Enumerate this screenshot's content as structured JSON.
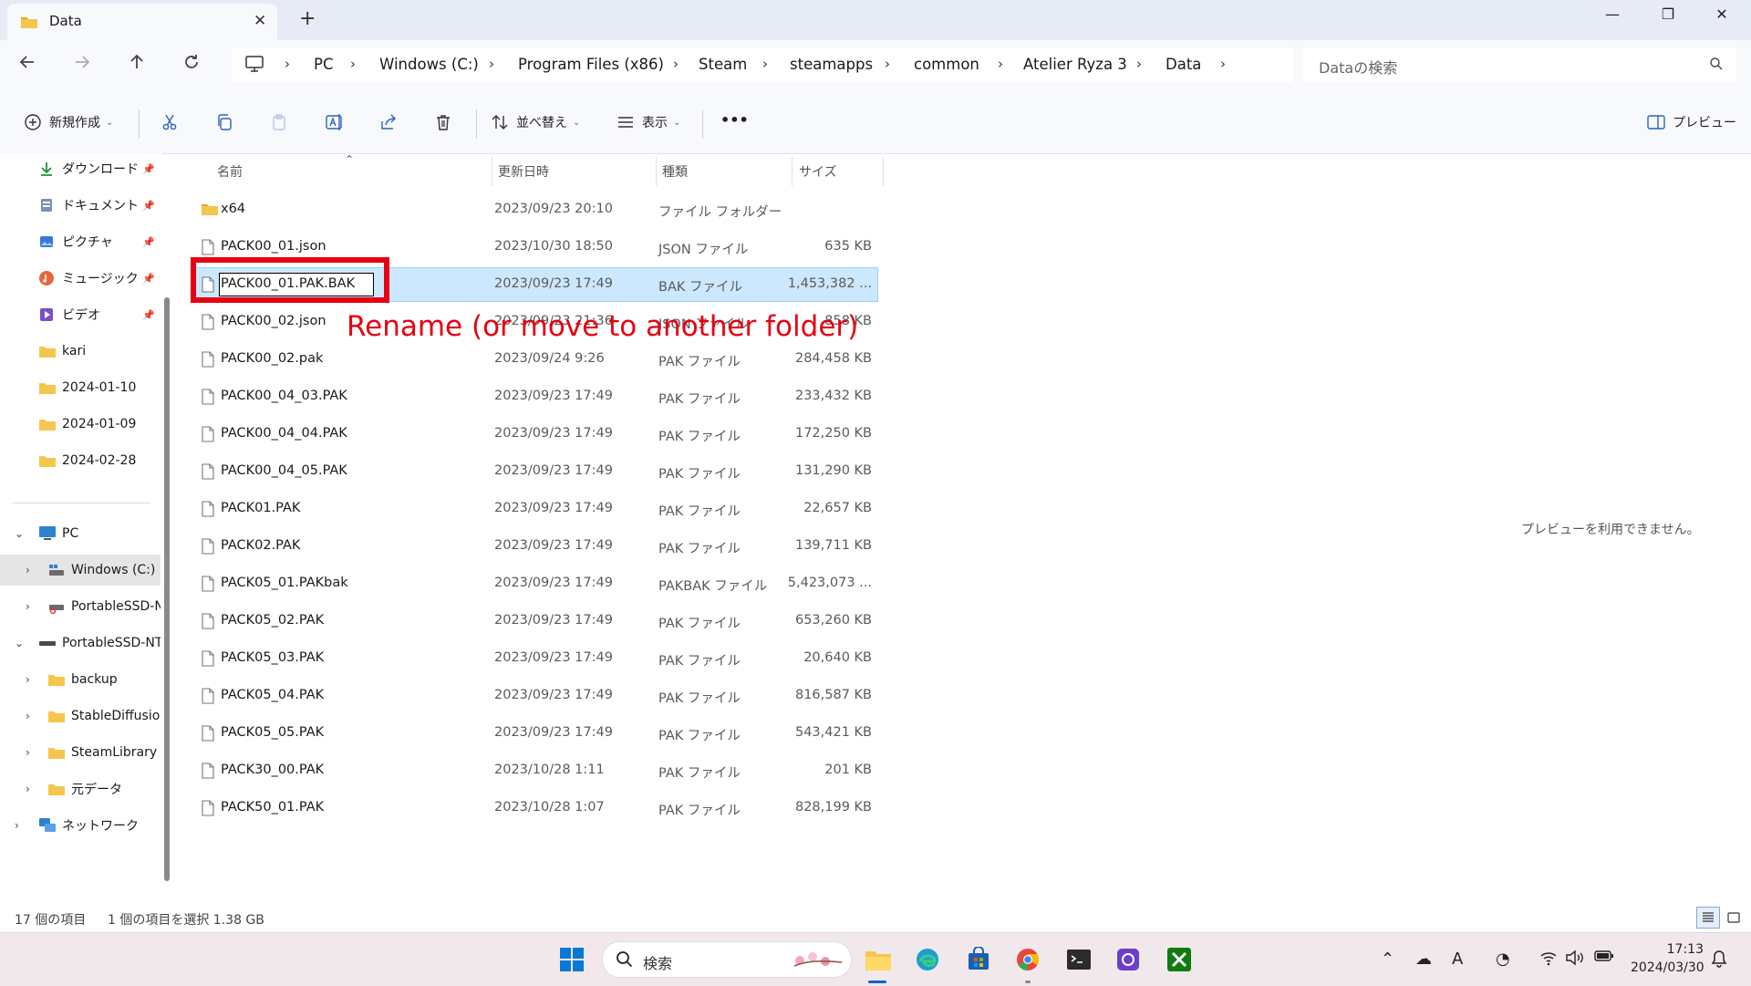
{
  "window": {
    "tab_title": "Data",
    "tab_close": "✕",
    "new_tab": "+",
    "minimize": "—",
    "maximize": "❐",
    "close": "✕"
  },
  "breadcrumb": [
    "PC",
    "Windows (C:)",
    "Program Files (x86)",
    "Steam",
    "steamapps",
    "common",
    "Atelier Ryza 3",
    "Data"
  ],
  "search": {
    "placeholder": "Dataの検索"
  },
  "commandbar": {
    "new_label": "新規作成",
    "sort_label": "並べ替え",
    "view_label": "表示",
    "more_label": "•••",
    "preview_label": "プレビュー"
  },
  "sidebar": {
    "quick_access": [
      {
        "label": "ダウンロード",
        "icon": "download-icon",
        "pinned": true
      },
      {
        "label": "ドキュメント",
        "icon": "documents-icon",
        "pinned": true
      },
      {
        "label": "ピクチャ",
        "icon": "pictures-icon",
        "pinned": true
      },
      {
        "label": "ミュージック",
        "icon": "music-icon",
        "pinned": true
      },
      {
        "label": "ビデオ",
        "icon": "videos-icon",
        "pinned": true
      },
      {
        "label": "kari",
        "icon": "folder-icon",
        "pinned": false
      },
      {
        "label": "2024-01-10",
        "icon": "folder-icon",
        "pinned": false
      },
      {
        "label": "2024-01-09",
        "icon": "folder-icon",
        "pinned": false
      },
      {
        "label": "2024-02-28",
        "icon": "folder-icon",
        "pinned": false
      }
    ],
    "tree": [
      {
        "label": "PC",
        "icon": "pc-icon",
        "expanded": true,
        "level": 0
      },
      {
        "label": "Windows (C:)",
        "icon": "drive-icon",
        "expanded": false,
        "level": 1,
        "selected": true
      },
      {
        "label": "PortableSSD-N",
        "icon": "usb-drive-icon",
        "expanded": false,
        "level": 1
      },
      {
        "label": "PortableSSD-NT",
        "icon": "drive-icon",
        "expanded": true,
        "level": 0
      },
      {
        "label": "backup",
        "icon": "folder-icon",
        "expanded": false,
        "level": 1
      },
      {
        "label": "StableDiffusion",
        "icon": "folder-icon",
        "expanded": false,
        "level": 1
      },
      {
        "label": "SteamLibrary",
        "icon": "folder-icon",
        "expanded": false,
        "level": 1
      },
      {
        "label": "元データ",
        "icon": "folder-icon",
        "expanded": false,
        "level": 1
      },
      {
        "label": "ネットワーク",
        "icon": "network-icon",
        "expanded": false,
        "level": 0
      }
    ]
  },
  "columns": {
    "name": "名前",
    "date": "更新日時",
    "type": "種類",
    "size": "サイズ"
  },
  "files": [
    {
      "name": "x64",
      "date": "2023/09/23 20:10",
      "type": "ファイル フォルダー",
      "size": "",
      "is_folder": true
    },
    {
      "name": "PACK00_01.json",
      "date": "2023/10/30 18:50",
      "type": "JSON ファイル",
      "size": "635 KB"
    },
    {
      "name": "PACK00_01.PAK.BAK",
      "date": "2023/09/23 17:49",
      "type": "BAK ファイル",
      "size": "1,453,382 ...",
      "selected": true,
      "renaming": true
    },
    {
      "name": "PACK00_02.json",
      "date": "2023/09/23 21:36",
      "type": "JSON ファイル",
      "size": "858 KB"
    },
    {
      "name": "PACK00_02.pak",
      "date": "2023/09/24 9:26",
      "type": "PAK ファイル",
      "size": "284,458 KB"
    },
    {
      "name": "PACK00_04_03.PAK",
      "date": "2023/09/23 17:49",
      "type": "PAK ファイル",
      "size": "233,432 KB"
    },
    {
      "name": "PACK00_04_04.PAK",
      "date": "2023/09/23 17:49",
      "type": "PAK ファイル",
      "size": "172,250 KB"
    },
    {
      "name": "PACK00_04_05.PAK",
      "date": "2023/09/23 17:49",
      "type": "PAK ファイル",
      "size": "131,290 KB"
    },
    {
      "name": "PACK01.PAK",
      "date": "2023/09/23 17:49",
      "type": "PAK ファイル",
      "size": "22,657 KB"
    },
    {
      "name": "PACK02.PAK",
      "date": "2023/09/23 17:49",
      "type": "PAK ファイル",
      "size": "139,711 KB"
    },
    {
      "name": "PACK05_01.PAKbak",
      "date": "2023/09/23 17:49",
      "type": "PAKBAK ファイル",
      "size": "5,423,073 ..."
    },
    {
      "name": "PACK05_02.PAK",
      "date": "2023/09/23 17:49",
      "type": "PAK ファイル",
      "size": "653,260 KB"
    },
    {
      "name": "PACK05_03.PAK",
      "date": "2023/09/23 17:49",
      "type": "PAK ファイル",
      "size": "20,640 KB"
    },
    {
      "name": "PACK05_04.PAK",
      "date": "2023/09/23 17:49",
      "type": "PAK ファイル",
      "size": "816,587 KB"
    },
    {
      "name": "PACK05_05.PAK",
      "date": "2023/09/23 17:49",
      "type": "PAK ファイル",
      "size": "543,421 KB"
    },
    {
      "name": "PACK30_00.PAK",
      "date": "2023/10/28 1:11",
      "type": "PAK ファイル",
      "size": "201 KB"
    },
    {
      "name": "PACK50_01.PAK",
      "date": "2023/10/28 1:07",
      "type": "PAK ファイル",
      "size": "828,199 KB"
    }
  ],
  "annotation": {
    "text": "Rename (or move to another folder)",
    "color": "#e60012"
  },
  "preview": {
    "message": "プレビューを利用できません。"
  },
  "status": {
    "item_count": "17 個の項目",
    "selection": "1 個の項目を選択  1.38 GB"
  },
  "taskbar": {
    "search_placeholder": "検索",
    "time": "17:13",
    "date": "2024/03/30",
    "apps": [
      "windows-start-icon",
      "file-explorer-icon",
      "edge-icon",
      "store-icon",
      "chrome-icon",
      "terminal-icon",
      "app-icon",
      "xbox-icon"
    ]
  },
  "colors": {
    "accent": "#0067c0",
    "selection": "#cce8ff",
    "titlebar": "#e6ebf5",
    "taskbar": "#f1e8ec"
  }
}
